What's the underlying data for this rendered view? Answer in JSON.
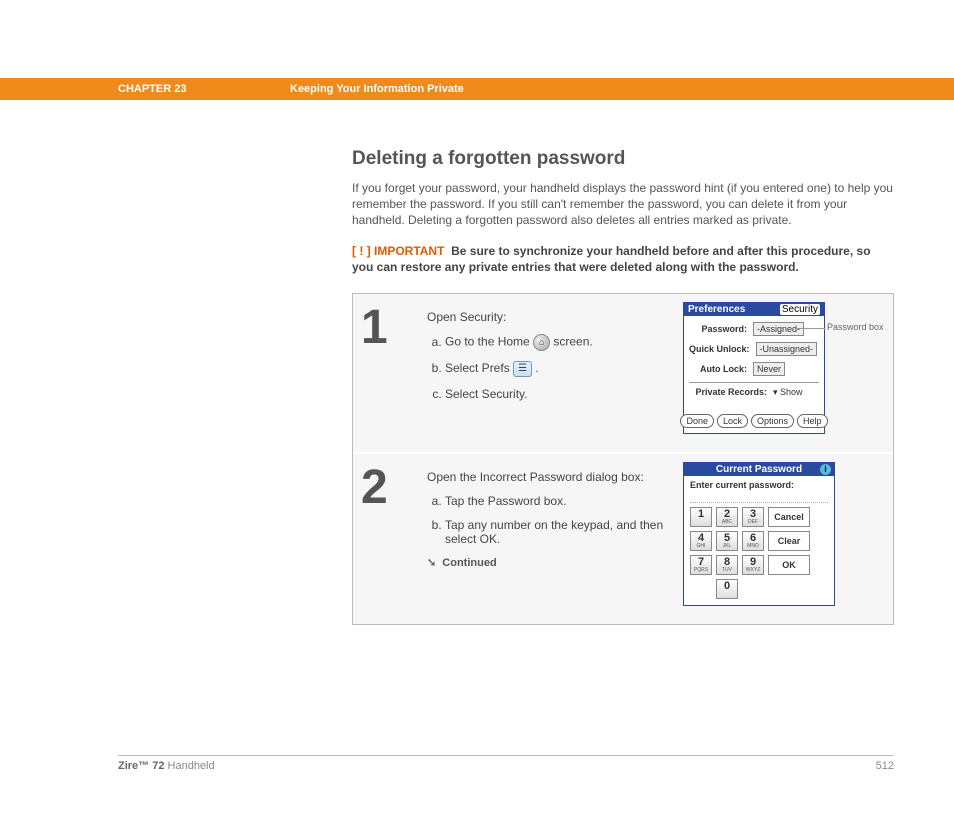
{
  "header": {
    "chapter": "CHAPTER 23",
    "title": "Keeping Your Information Private"
  },
  "section": {
    "heading": "Deleting a forgotten password",
    "intro": "If you forget your password, your handheld displays the password hint (if you entered one) to help you remember the password. If you still can't remember the password, you can delete it from your handheld. Deleting a forgotten password also deletes all entries marked as private.",
    "important_tag": "[ ! ] IMPORTANT",
    "important_text": "Be sure to synchronize your handheld before and after this procedure, so you can restore any private entries that were deleted along with the password."
  },
  "steps": [
    {
      "num": "1",
      "lead": "Open Security:",
      "items": {
        "a_pre": "Go to the Home ",
        "a_post": " screen.",
        "b_pre": "Select Prefs ",
        "b_post": ".",
        "c": "Select Security."
      },
      "callout": "Password box",
      "palm": {
        "hdr_left": "Preferences",
        "hdr_right": "Security",
        "row1_lbl": "Password:",
        "row1_val": "-Assigned-",
        "row2_lbl": "Quick Unlock:",
        "row2_val": "-Unassigned-",
        "row3_lbl": "Auto Lock:",
        "row3_val": "Never",
        "row4_lbl": "Private Records:",
        "row4_val": "▾ Show",
        "btns": [
          "Done",
          "Lock",
          "Options",
          "Help"
        ]
      }
    },
    {
      "num": "2",
      "lead": "Open the Incorrect Password dialog box:",
      "items": {
        "a": "Tap the Password box.",
        "b": "Tap any number on the keypad, and then select OK."
      },
      "continued": "Continued",
      "kp": {
        "title": "Current Password",
        "prompt": "Enter current password:",
        "keys": [
          {
            "n": "1",
            "t": ""
          },
          {
            "n": "2",
            "t": "ABC"
          },
          {
            "n": "3",
            "t": "DEF"
          },
          {
            "n": "4",
            "t": "GHI"
          },
          {
            "n": "5",
            "t": "JKL"
          },
          {
            "n": "6",
            "t": "MNO"
          },
          {
            "n": "7",
            "t": "PQRS"
          },
          {
            "n": "8",
            "t": "TUV"
          },
          {
            "n": "9",
            "t": "WXYZ"
          }
        ],
        "zero": {
          "n": "0",
          "t": ""
        },
        "side": [
          "Cancel",
          "Clear",
          "OK"
        ]
      }
    }
  ],
  "footer": {
    "product_bold": "Zire™ 72",
    "product_rest": " Handheld",
    "page": "512"
  }
}
